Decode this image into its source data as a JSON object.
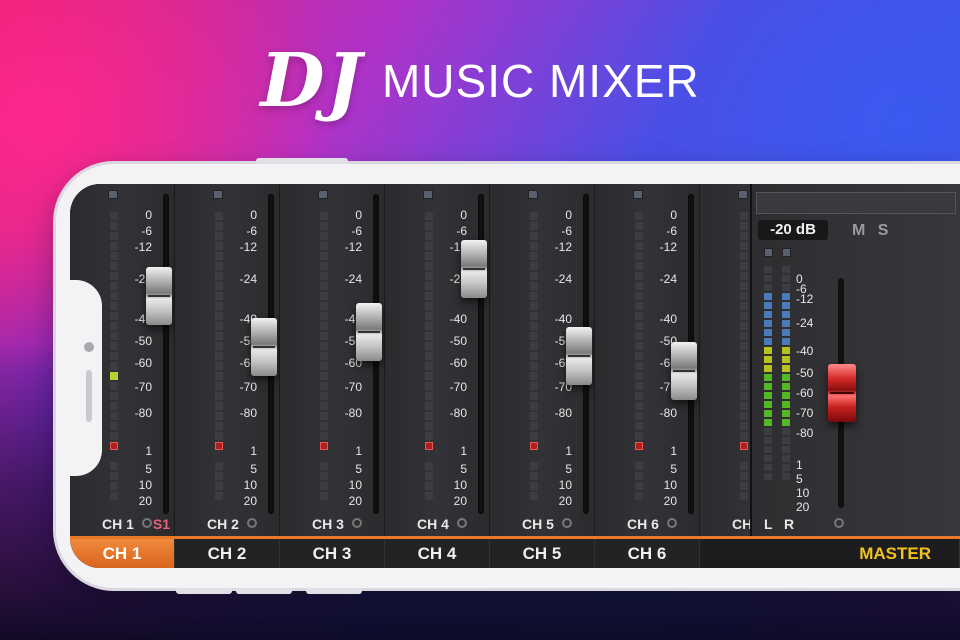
{
  "header": {
    "title_main": "DJ",
    "title_sub": "MUSIC MIXER"
  },
  "scale_labels": [
    "0",
    "-6",
    "-12",
    "-24",
    "-40",
    "-50",
    "-60",
    "-70",
    "-80",
    "1",
    "5",
    "10",
    "20"
  ],
  "channels": [
    {
      "label": "CH 1",
      "fader_level": 0.77,
      "solo": "S1",
      "meter_lit": true
    },
    {
      "label": "CH 2",
      "fader_level": 0.6
    },
    {
      "label": "CH 3",
      "fader_level": 0.65
    },
    {
      "label": "CH 4",
      "fader_level": 0.86
    },
    {
      "label": "CH 5",
      "fader_level": 0.57
    },
    {
      "label": "CH 6",
      "fader_level": 0.52
    }
  ],
  "partial_channel_label": "CH",
  "master": {
    "db_value": "-20 dB",
    "mute_solo": "M S",
    "left_label": "L",
    "right_label": "R",
    "scale_labels": [
      "0",
      "-6",
      "-12",
      "-24",
      "-40",
      "-50",
      "-60",
      "-70",
      "-80",
      "1",
      "5",
      "10",
      "20"
    ],
    "fader_level": 0.55
  },
  "tabs": [
    "CH 1",
    "CH 2",
    "CH 3",
    "CH 4",
    "CH 5",
    "CH 6"
  ],
  "master_tab": "MASTER",
  "colors": {
    "accent": "#e87a2a",
    "master_text": "#f2c21a",
    "solo_text": "#e8607a"
  }
}
